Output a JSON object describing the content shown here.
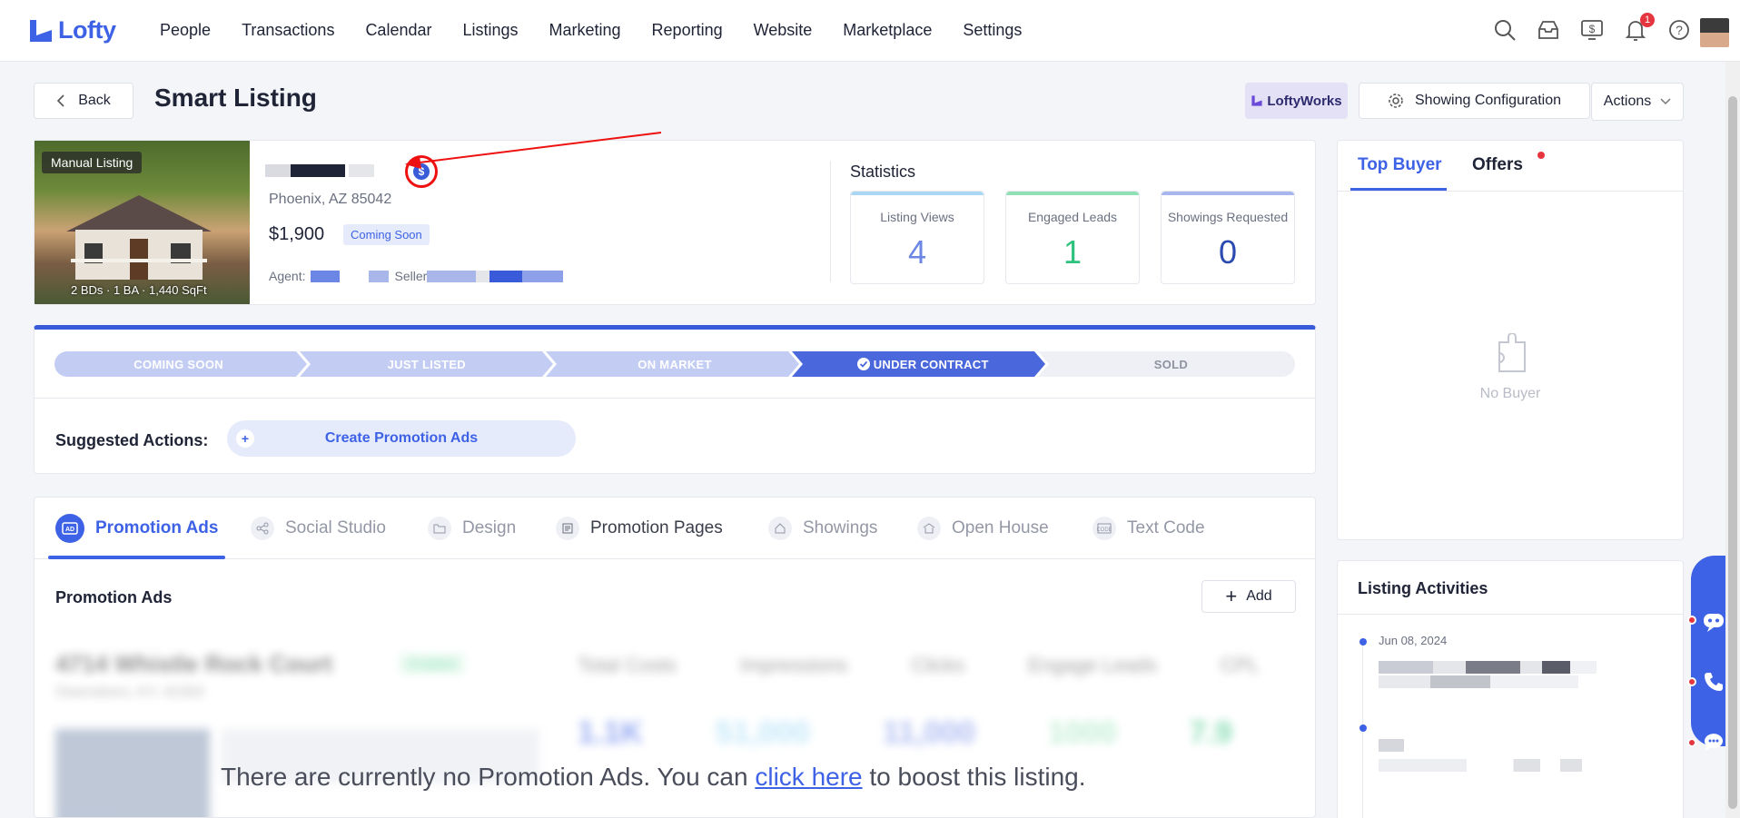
{
  "app": {
    "logo": "Lofty"
  },
  "nav": {
    "items": [
      "People",
      "Transactions",
      "Calendar",
      "Listings",
      "Marketing",
      "Reporting",
      "Website",
      "Marketplace",
      "Settings"
    ],
    "notification_count": "1"
  },
  "header": {
    "back_label": "Back",
    "title": "Smart Listing",
    "loftyworks_label": "LoftyWorks",
    "showing_config_label": "Showing Configuration",
    "actions_label": "Actions"
  },
  "listing": {
    "tag": "Manual Listing",
    "photo_caption": "2 BDs · 1 BA · 1,440 SqFt",
    "currency_symbol": "$",
    "address": "Phoenix, AZ 85042",
    "price": "$1,900",
    "status": "Coming Soon",
    "agent_label": "Agent:",
    "seller_label": "Seller"
  },
  "statistics": {
    "title": "Statistics",
    "cards": [
      {
        "label": "Listing Views",
        "value": "4",
        "color": "#6c86e6",
        "accent": "#a9d7f3"
      },
      {
        "label": "Engaged Leads",
        "value": "1",
        "color": "#2ec27e",
        "accent": "#8fe0b4"
      },
      {
        "label": "Showings Requested",
        "value": "0",
        "color": "#2c4bb0",
        "accent": "#a8b6f0"
      }
    ]
  },
  "pipeline": {
    "stages": [
      "COMING SOON",
      "JUST LISTED",
      "ON MARKET",
      "UNDER CONTRACT",
      "SOLD"
    ],
    "active_index": 3
  },
  "suggested": {
    "label": "Suggested Actions:",
    "button": "Create Promotion Ads"
  },
  "tabs": {
    "items": [
      {
        "label": "Promotion Ads",
        "icon": "ad-icon"
      },
      {
        "label": "Social Studio",
        "icon": "share-icon"
      },
      {
        "label": "Design",
        "icon": "folder-icon"
      },
      {
        "label": "Promotion Pages",
        "icon": "page-icon"
      },
      {
        "label": "Showings",
        "icon": "home-icon"
      },
      {
        "label": "Open House",
        "icon": "house-icon"
      },
      {
        "label": "Text Code",
        "icon": "code-icon"
      }
    ]
  },
  "promotion": {
    "section_title": "Promotion Ads",
    "add_label": "Add",
    "empty_prefix": "There are currently no Promotion Ads. You can ",
    "empty_link": "click here",
    "empty_suffix": " to boost this listing.",
    "blur_sample": {
      "address": "4714 Whistle Rock Court",
      "city": "Owensboro, KY, 42303",
      "cols": [
        "Total Costs",
        "Impressions",
        "Clicks",
        "Engage Leads",
        "CPL"
      ],
      "vals": [
        "1.1K",
        "51,000",
        "11,000",
        "1000",
        "7.9"
      ],
      "chip": "Enabled"
    }
  },
  "buyer": {
    "tab_top_buyer": "Top Buyer",
    "tab_offers": "Offers",
    "empty": "No Buyer"
  },
  "activities": {
    "title": "Listing Activities",
    "date": "Jun 08, 2024"
  }
}
